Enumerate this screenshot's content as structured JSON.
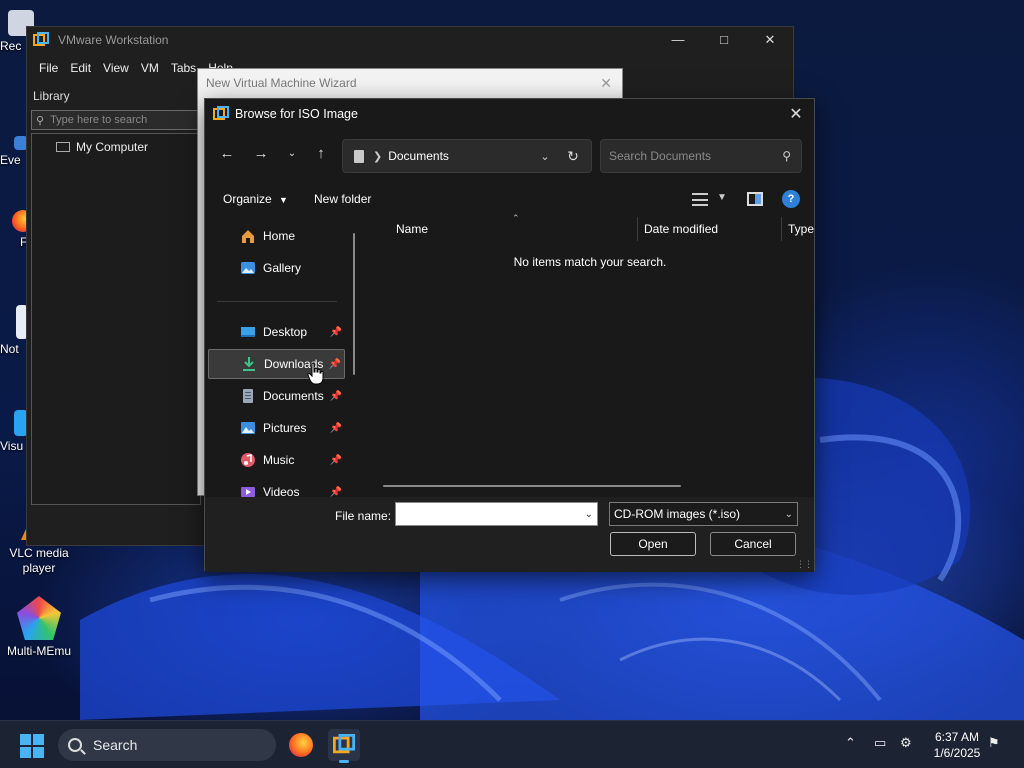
{
  "desktop": {
    "icons": [
      {
        "label": "VLC media\nplayer",
        "line1": "VLC media",
        "line2": "player"
      },
      {
        "label": "Multi-MEmu"
      }
    ],
    "partial_labels": [
      "Rec",
      "Eve",
      "F",
      "Not",
      "Visu"
    ]
  },
  "vmware": {
    "title": "VMware Workstation",
    "menu": [
      "File",
      "Edit",
      "View",
      "VM",
      "Tabs",
      "Help"
    ],
    "library": {
      "heading": "Library",
      "search_placeholder": "Type here to search",
      "items": [
        "My Computer"
      ]
    }
  },
  "wizard": {
    "title": "New Virtual Machine Wizard"
  },
  "dialog": {
    "title": "Browse for ISO Image",
    "address": {
      "crumb": "Documents"
    },
    "search_placeholder": "Search Documents",
    "toolbar": {
      "organize": "Organize",
      "new_folder": "New folder"
    },
    "nav": {
      "items": [
        {
          "label": "Home",
          "icon": "home-icon",
          "pinned": false
        },
        {
          "label": "Gallery",
          "icon": "gallery-icon",
          "pinned": false
        },
        {
          "label": "Desktop",
          "icon": "desktop-folder-icon",
          "pinned": true
        },
        {
          "label": "Downloads",
          "icon": "downloads-icon",
          "pinned": true,
          "selected": true
        },
        {
          "label": "Documents",
          "icon": "documents-icon",
          "pinned": true
        },
        {
          "label": "Pictures",
          "icon": "pictures-icon",
          "pinned": true
        },
        {
          "label": "Music",
          "icon": "music-icon",
          "pinned": true
        },
        {
          "label": "Videos",
          "icon": "videos-icon",
          "pinned": true
        }
      ]
    },
    "columns": [
      "Name",
      "Date modified",
      "Type"
    ],
    "empty_message": "No items match your search.",
    "file_name_label": "File name:",
    "file_name_value": "",
    "file_type": "CD-ROM images (*.iso)",
    "open_label": "Open",
    "cancel_label": "Cancel"
  },
  "taskbar": {
    "search_label": "Search",
    "time": "6:37 AM",
    "date": "1/6/2025"
  },
  "colors": {
    "accent": "#4ab3f4",
    "dialog_bg": "#191919",
    "selected_bg": "#3a3a3a"
  }
}
